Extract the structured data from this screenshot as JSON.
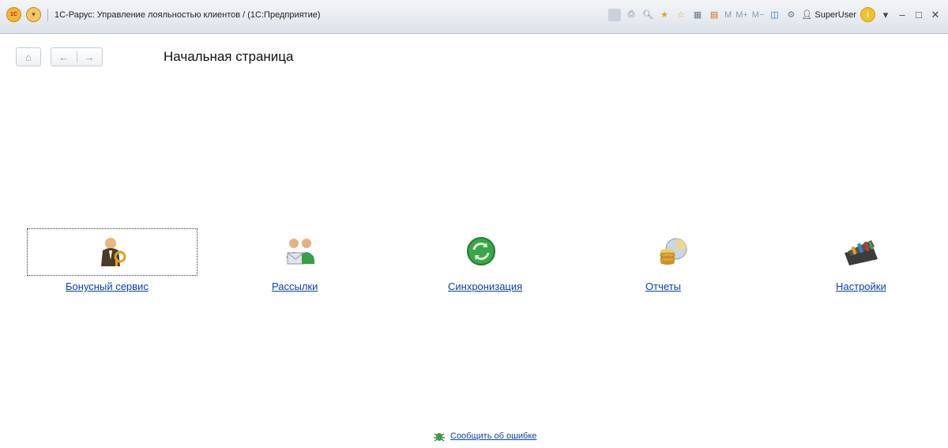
{
  "window": {
    "title": "1С-Рарус: Управление лояльностью клиентов /  (1С:Предприятие)",
    "logo_text": "1С",
    "user": "SuperUser",
    "toolbar": {
      "m": "M",
      "m_plus": "M+",
      "m_minus": "M−"
    }
  },
  "page": {
    "title": "Начальная страница"
  },
  "sections": [
    {
      "label": "Бонусный сервис",
      "icon": "user-key-icon"
    },
    {
      "label": "Рассылки",
      "icon": "mailing-icon"
    },
    {
      "label": "Синхронизация",
      "icon": "sync-icon"
    },
    {
      "label": "Отчеты",
      "icon": "reports-icon"
    },
    {
      "label": "Настройки",
      "icon": "settings-toolbox-icon"
    }
  ],
  "footer": {
    "report_error": "Сообщить об ошибке"
  },
  "colors": {
    "link": "#0b3fae",
    "sync": "#3aa64a",
    "coin": "#d9a43a"
  }
}
